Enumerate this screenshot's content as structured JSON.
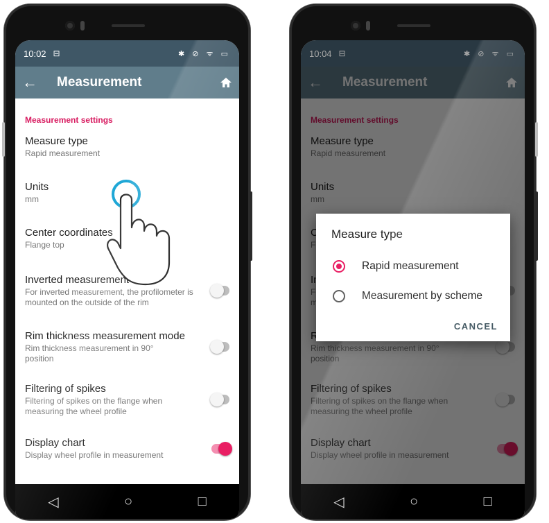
{
  "left_screen": {
    "status": {
      "time": "10:02",
      "icons": "✱ ⊘ ᯤ ▭"
    },
    "appbar": {
      "back": "←",
      "title": "Measurement",
      "home_icon": "home-icon"
    },
    "section": "Measurement settings",
    "items": [
      {
        "title": "Measure type",
        "subtitle": "Rapid measurement"
      },
      {
        "title": "Units",
        "subtitle": "mm"
      },
      {
        "title": "Center coordinates",
        "subtitle": "Flange top"
      },
      {
        "title": "Inverted measurement",
        "subtitle": "For inverted measurement, the profilometer is mounted on the outside of the rim",
        "toggle": false
      },
      {
        "title": "Rim thickness measurement mode",
        "subtitle": "Rim thickness measurement in 90° position",
        "toggle": false
      },
      {
        "title": "Filtering of spikes",
        "subtitle": "Filtering of spikes on the flange when measuring the wheel profile",
        "toggle": false
      },
      {
        "title": "Display chart",
        "subtitle": "Display wheel profile in measurement",
        "toggle": true
      }
    ],
    "nav": {
      "back": "◁",
      "home": "○",
      "recent": "□"
    }
  },
  "right_screen": {
    "status": {
      "time": "10:04",
      "icons": "✱ ⊘ ᯤ ▭"
    },
    "dialog": {
      "title": "Measure type",
      "options": [
        {
          "label": "Rapid measurement",
          "selected": true
        },
        {
          "label": "Measurement by scheme",
          "selected": false
        }
      ],
      "cancel": "CANCEL"
    }
  },
  "colors": {
    "appbar": "#607d8b",
    "statusbar": "#3f5766",
    "accent": "#e91e63",
    "section": "#d81b60",
    "tap_ring": "#1fa7d6"
  }
}
